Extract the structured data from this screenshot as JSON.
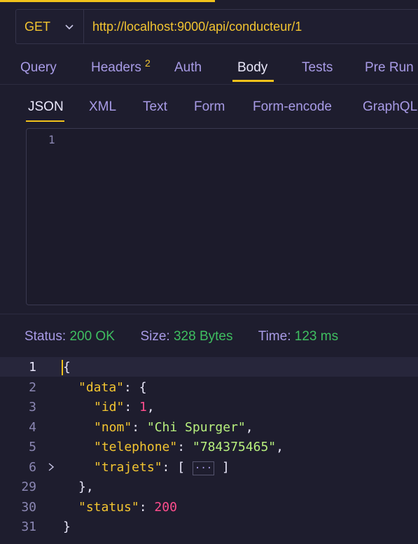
{
  "request": {
    "method": "GET",
    "url": "http://localhost:9000/api/conducteur/1"
  },
  "tabs": {
    "query": "Query",
    "headers": "Headers",
    "headers_count": "2",
    "auth": "Auth",
    "body": "Body",
    "tests": "Tests",
    "pre_run": "Pre Run"
  },
  "body_tabs": {
    "json": "JSON",
    "xml": "XML",
    "text": "Text",
    "form": "Form",
    "form_encode": "Form-encode",
    "graphql": "GraphQL"
  },
  "editor": {
    "line1": "1"
  },
  "status_bar": {
    "status_label": "Status:",
    "status_value": "200 OK",
    "size_label": "Size:",
    "size_value": "328 Bytes",
    "time_label": "Time:",
    "time_value": "123 ms"
  },
  "response": {
    "line_numbers": [
      "1",
      "2",
      "3",
      "4",
      "5",
      "6",
      "29",
      "30",
      "31"
    ],
    "lines": {
      "l1_open": "{",
      "l2_key": "\"data\"",
      "l2_rest": ": {",
      "l3_key": "\"id\"",
      "l3_colon": ": ",
      "l3_val": "1",
      "l3_comma": ",",
      "l4_key": "\"nom\"",
      "l4_colon": ": ",
      "l4_val": "\"Chi Spurger\"",
      "l4_comma": ",",
      "l5_key": "\"telephone\"",
      "l5_colon": ": ",
      "l5_val": "\"784375465\"",
      "l5_comma": ",",
      "l6_key": "\"trajets\"",
      "l6_colon": ": [ ",
      "l6_collapsed": "···",
      "l6_close": " ]",
      "l29": "},",
      "l30_key": "\"status\"",
      "l30_colon": ": ",
      "l30_val": "200",
      "l31_close": "}"
    }
  },
  "colors": {
    "accent": "#f1c21b",
    "status_ok": "#3fbf60",
    "tab_text": "#a89be6"
  }
}
